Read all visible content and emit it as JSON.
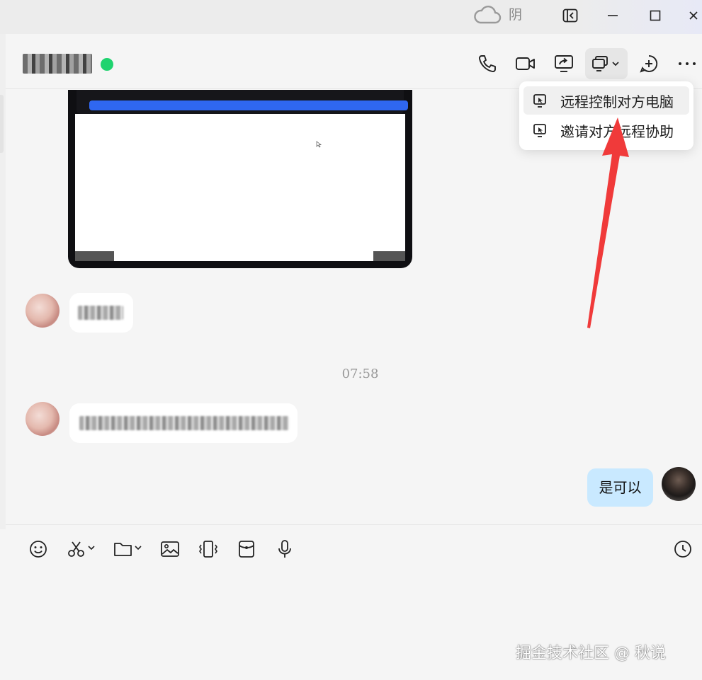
{
  "window": {
    "weather_label": "阴",
    "icons": [
      "cloud-icon",
      "sidebar-toggle-icon",
      "minimize-icon",
      "maximize-icon",
      "close-icon"
    ]
  },
  "chat_header": {
    "contact_status_color": "#1fd36f",
    "actions": [
      "phone-icon",
      "video-icon",
      "share-screen-icon",
      "remote-screen-icon",
      "add-chat-icon",
      "more-icon"
    ]
  },
  "dropdown": {
    "items": [
      {
        "label": "远程控制对方电脑",
        "icon": "remote-control-icon"
      },
      {
        "label": "邀请对方远程协助",
        "icon": "remote-assist-icon"
      }
    ]
  },
  "messages": {
    "timestamp": "07:58",
    "my_message": "是可以"
  },
  "toolbar": {
    "icons": [
      "emoji-icon",
      "scissors-icon",
      "folder-icon",
      "image-icon",
      "shake-icon",
      "red-packet-icon",
      "microphone-icon",
      "history-clock-icon"
    ]
  },
  "watermark": "掘金技术社区 @ 秋说",
  "colors": {
    "accent_bubble": "#c9e9ff",
    "arrow": "#f03a3a",
    "online": "#1fd36f"
  }
}
